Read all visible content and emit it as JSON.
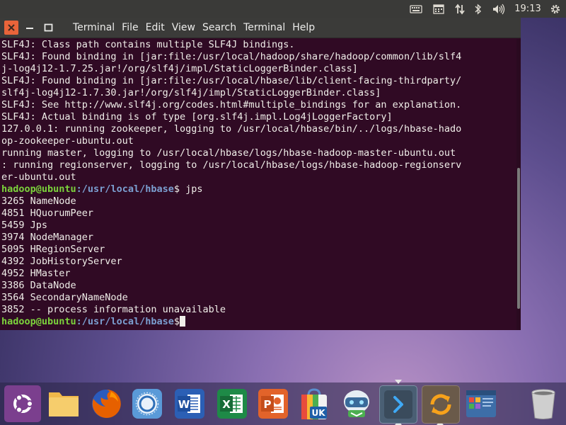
{
  "top_panel": {
    "clock": "19:13",
    "indicators": [
      "keyboard-icon",
      "calendar-icon",
      "network-arrows-icon",
      "bluetooth-icon",
      "volume-icon",
      "power-gear-icon"
    ]
  },
  "window": {
    "close_icon": "close-icon",
    "menus": [
      "Terminal",
      "File",
      "Edit",
      "View",
      "Search",
      "Terminal",
      "Help"
    ]
  },
  "terminal": {
    "lines": [
      "SLF4J: Class path contains multiple SLF4J bindings.",
      "SLF4J: Found binding in [jar:file:/usr/local/hadoop/share/hadoop/common/lib/slf4",
      "j-log4j12-1.7.25.jar!/org/slf4j/impl/StaticLoggerBinder.class]",
      "SLF4J: Found binding in [jar:file:/usr/local/hbase/lib/client-facing-thirdparty/",
      "slf4j-log4j12-1.7.30.jar!/org/slf4j/impl/StaticLoggerBinder.class]",
      "SLF4J: See http://www.slf4j.org/codes.html#multiple_bindings for an explanation.",
      "SLF4J: Actual binding is of type [org.slf4j.impl.Log4jLoggerFactory]",
      "127.0.0.1: running zookeeper, logging to /usr/local/hbase/bin/../logs/hbase-hado",
      "op-zookeeper-ubuntu.out",
      "running master, logging to /usr/local/hbase/logs/hbase-hadoop-master-ubuntu.out",
      ": running regionserver, logging to /usr/local/hbase/logs/hbase-hadoop-regionserv",
      "er-ubuntu.out"
    ],
    "prompt": {
      "user_host": "hadoop@ubuntu",
      "path": ":/usr/local/hbase",
      "symbol": "$ ",
      "command": "jps"
    },
    "jps_output": [
      "3265 NameNode",
      "4851 HQuorumPeer",
      "5459 Jps",
      "3974 NodeManager",
      "5095 HRegionServer",
      "4392 JobHistoryServer",
      "4952 HMaster",
      "3386 DataNode",
      "3564 SecondaryNameNode",
      "3852 -- process information unavailable"
    ],
    "final_prompt": {
      "user_host": "hadoop@ubuntu",
      "path": ":/usr/local/hbase",
      "symbol": "$"
    }
  },
  "dock": {
    "items": [
      {
        "name": "ubuntu-launcher-icon",
        "color": "#7b3f8e"
      },
      {
        "name": "files-folder-icon",
        "color": "#f2c060"
      },
      {
        "name": "firefox-icon",
        "color": "#e66000"
      },
      {
        "name": "software-center-icon",
        "color": "#4c8fd0"
      },
      {
        "name": "word-icon",
        "color": "#2b5fb5",
        "label": "W"
      },
      {
        "name": "excel-icon",
        "color": "#1e8a47",
        "label": "X"
      },
      {
        "name": "powerpoint-icon",
        "color": "#e2632a",
        "label": "P"
      },
      {
        "name": "shopping-bag-icon",
        "color": "#e9e9e9",
        "label": "UK"
      },
      {
        "name": "robot-icon",
        "color": "#8ab2cf"
      },
      {
        "name": "terminal-icon",
        "color": "#3a4a5a"
      },
      {
        "name": "software-updater-icon",
        "color": "#6a5a4a"
      },
      {
        "name": "window-manager-icon",
        "color": "#3d6ea8"
      },
      {
        "name": "trash-icon",
        "color": "#c8c8c8"
      }
    ]
  }
}
